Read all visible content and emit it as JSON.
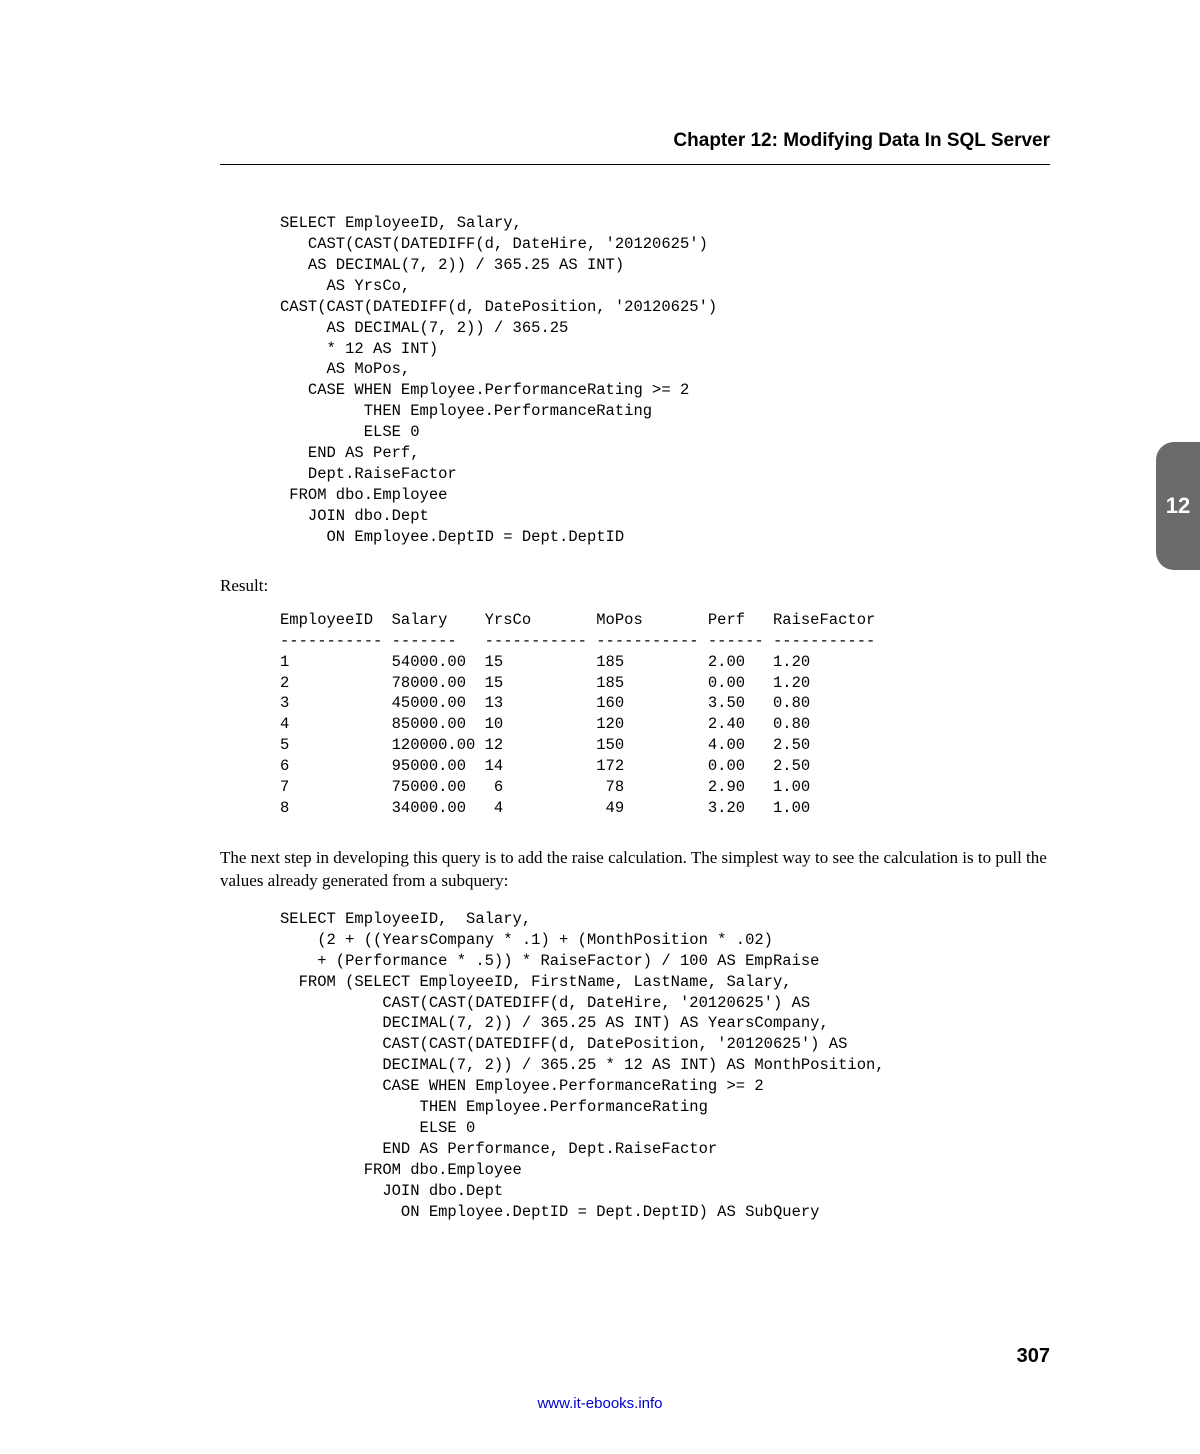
{
  "header": {
    "chapter_title": "Chapter 12: Modifying Data In SQL Server"
  },
  "tab": {
    "number": "12"
  },
  "page_number": "307",
  "footer": {
    "link_text": "www.it-ebooks.info",
    "link_href": "http://www.it-ebooks.info"
  },
  "code1": "SELECT EmployeeID, Salary,\n   CAST(CAST(DATEDIFF(d, DateHire, '20120625')\n   AS DECIMAL(7, 2)) / 365.25 AS INT)\n     AS YrsCo,\nCAST(CAST(DATEDIFF(d, DatePosition, '20120625')\n     AS DECIMAL(7, 2)) / 365.25\n     * 12 AS INT)\n     AS MoPos,\n   CASE WHEN Employee.PerformanceRating >= 2\n         THEN Employee.PerformanceRating\n         ELSE 0\n   END AS Perf,\n   Dept.RaiseFactor\n FROM dbo.Employee\n   JOIN dbo.Dept\n     ON Employee.DeptID = Dept.DeptID",
  "result_label": "Result:",
  "result_table": "EmployeeID  Salary    YrsCo       MoPos       Perf   RaiseFactor\n----------- -------   ----------- ----------- ------ -----------\n1           54000.00  15          185         2.00   1.20\n2           78000.00  15          185         0.00   1.20\n3           45000.00  13          160         3.50   0.80\n4           85000.00  10          120         2.40   0.80\n5           120000.00 12          150         4.00   2.50\n6           95000.00  14          172         0.00   2.50\n7           75000.00   6           78         2.90   1.00\n8           34000.00   4           49         3.20   1.00",
  "body1": "The next step in developing this query is to add the raise calculation. The simplest way to see the calculation is to pull the values already generated from a subquery:",
  "code2": "SELECT EmployeeID,  Salary,\n    (2 + ((YearsCompany * .1) + (MonthPosition * .02)\n    + (Performance * .5)) * RaiseFactor) / 100 AS EmpRaise\n  FROM (SELECT EmployeeID, FirstName, LastName, Salary,\n           CAST(CAST(DATEDIFF(d, DateHire, '20120625') AS\n           DECIMAL(7, 2)) / 365.25 AS INT) AS YearsCompany,\n           CAST(CAST(DATEDIFF(d, DatePosition, '20120625') AS\n           DECIMAL(7, 2)) / 365.25 * 12 AS INT) AS MonthPosition,\n           CASE WHEN Employee.PerformanceRating >= 2\n               THEN Employee.PerformanceRating\n               ELSE 0\n           END AS Performance, Dept.RaiseFactor\n         FROM dbo.Employee\n           JOIN dbo.Dept\n             ON Employee.DeptID = Dept.DeptID) AS SubQuery"
}
